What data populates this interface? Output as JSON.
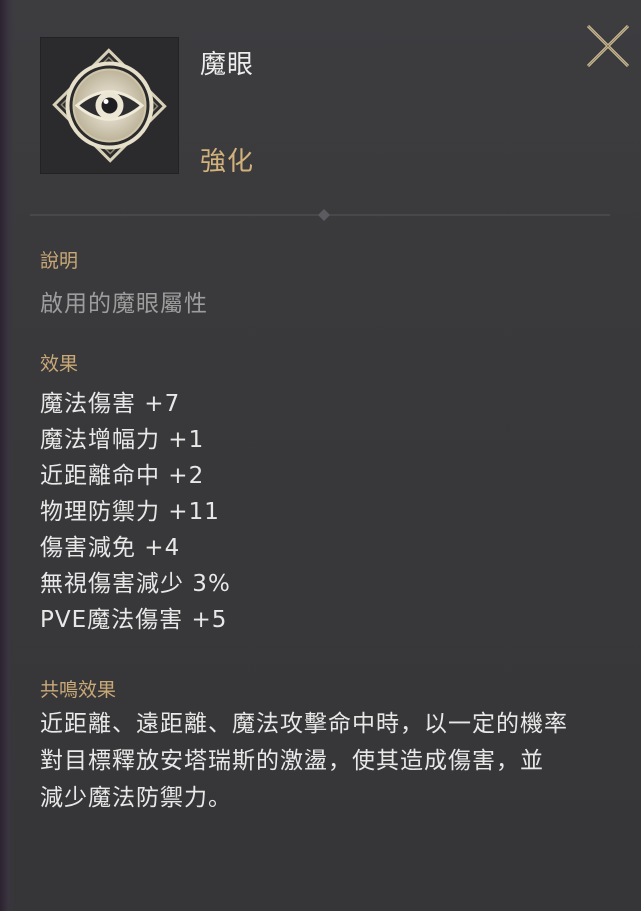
{
  "item": {
    "name": "魔眼",
    "grade": "強化",
    "icon": "eye-emblem-icon"
  },
  "description": {
    "label": "說明",
    "text": "啟用的魔眼屬性"
  },
  "effects": {
    "label": "效果",
    "items": [
      "魔法傷害 +7",
      "魔法增幅力 +1",
      "近距離命中 +2",
      "物理防禦力 +11",
      "傷害減免 +4",
      "無視傷害減少 3%",
      "PVE魔法傷害 +5"
    ]
  },
  "resonance": {
    "label": "共鳴效果",
    "lines": [
      "近距離、遠距離、魔法攻擊命中時，以一定的機率",
      "對目標釋放安塔瑞斯的激盪，使其造成傷害，並",
      "減少魔法防禦力。"
    ]
  },
  "colors": {
    "panel_bg": "#3a3a3d",
    "name": "#ededed",
    "grade_gold": "#d2b27a",
    "section_label": "#c9a877",
    "description": "#9d9d9d",
    "body_text": "#e8e8e8"
  }
}
